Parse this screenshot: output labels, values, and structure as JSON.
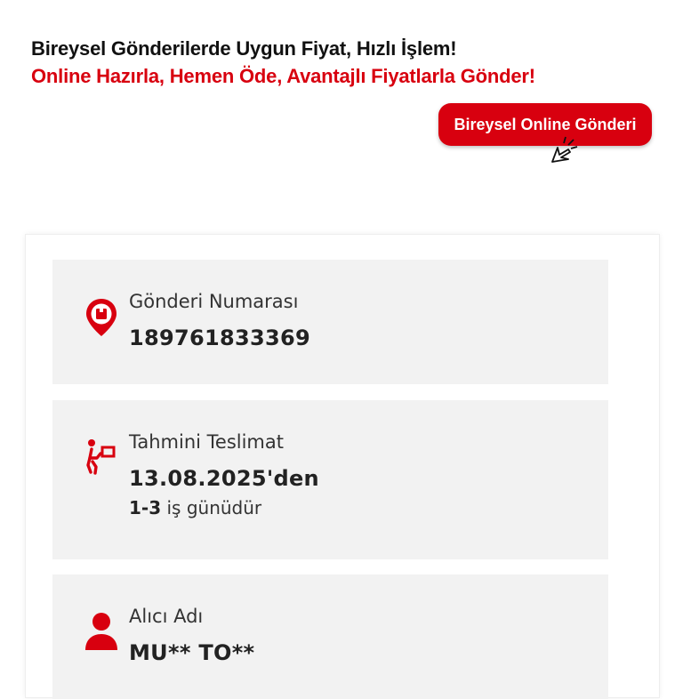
{
  "promo": {
    "line1": "Bireysel Gönderilerde Uygun Fiyat, Hızlı İşlem!",
    "line2": "Online Hazırla, Hemen Öde, Avantajlı Fiyatlarla Gönder!",
    "cta_label": "Bireysel Online Gönderi"
  },
  "shipment": {
    "number_label": "Gönderi Numarası",
    "number_value": "189761833369",
    "delivery_label": "Tahmini Teslimat",
    "delivery_value": "13.08.2025'den",
    "delivery_days": "1-3",
    "delivery_days_suffix": " iş günüdür",
    "recipient_label": "Alıcı Adı",
    "recipient_value": "MU** TO**"
  },
  "icons": {
    "number": "location-package-icon",
    "delivery": "courier-carrying-box-icon",
    "recipient": "person-icon",
    "cta_cursor": "click-cursor-icon"
  },
  "colors": {
    "brand_red": "#d8000f",
    "box_bg": "#f2f2f2",
    "text_dark": "#222222"
  }
}
